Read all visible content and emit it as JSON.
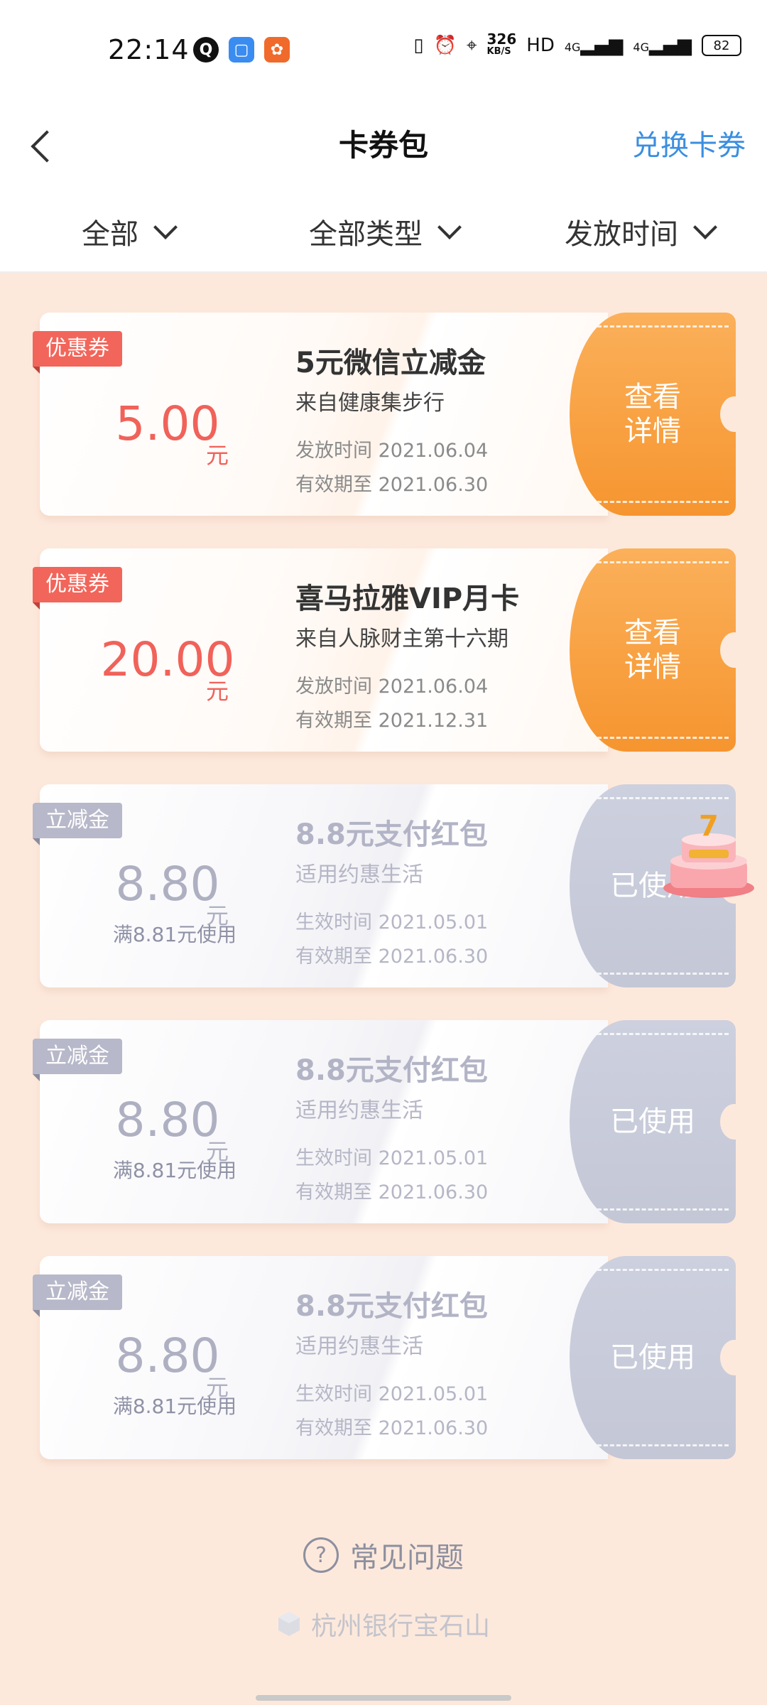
{
  "status": {
    "time": "22:14",
    "net_speed": "326",
    "net_unit": "KB/S",
    "hd": "HD",
    "signal1": "4G",
    "signal2": "4G",
    "battery": "82",
    "app_icons": [
      "q-app-icon",
      "blue-app-icon",
      "kuaishou-app-icon"
    ]
  },
  "header": {
    "title": "卡券包",
    "redeem": "兑换卡券"
  },
  "filters": [
    "全部",
    "全部类型",
    "发放时间"
  ],
  "coupons": [
    {
      "tag": "优惠券",
      "amount": "5.00",
      "unit": "元",
      "title": "5元微信立减金",
      "source": "来自健康集步行",
      "date1": "发放时间 2021.06.04",
      "date2": "有效期至 2021.06.30",
      "action": "查看详情",
      "state": "active"
    },
    {
      "tag": "优惠券",
      "amount": "20.00",
      "unit": "元",
      "title": "喜马拉雅VIP月卡",
      "source": "来自人脉财主第十六期",
      "date1": "发放时间 2021.06.04",
      "date2": "有效期至 2021.12.31",
      "action": "查看详情",
      "state": "active"
    },
    {
      "tag": "立减金",
      "amount": "8.80",
      "unit": "元",
      "condition": "满8.81元使用",
      "title": "8.8元支付红包",
      "source": "适用约惠生活",
      "date1": "生效时间 2021.05.01",
      "date2": "有效期至 2021.06.30",
      "action": "已使用",
      "state": "used"
    },
    {
      "tag": "立减金",
      "amount": "8.80",
      "unit": "元",
      "condition": "满8.81元使用",
      "title": "8.8元支付红包",
      "source": "适用约惠生活",
      "date1": "生效时间 2021.05.01",
      "date2": "有效期至 2021.06.30",
      "action": "已使用",
      "state": "used"
    },
    {
      "tag": "立减金",
      "amount": "8.80",
      "unit": "元",
      "condition": "满8.81元使用",
      "title": "8.8元支付红包",
      "source": "适用约惠生活",
      "date1": "生效时间 2021.05.01",
      "date2": "有效期至 2021.06.30",
      "action": "已使用",
      "state": "used"
    }
  ],
  "footer": {
    "faq": "常见问题",
    "bank": "杭州银行宝石山"
  },
  "colors": {
    "accent": "#3b8ee0",
    "orange": "#f6952f",
    "red": "#f0625a",
    "bg": "#fde9dc"
  }
}
